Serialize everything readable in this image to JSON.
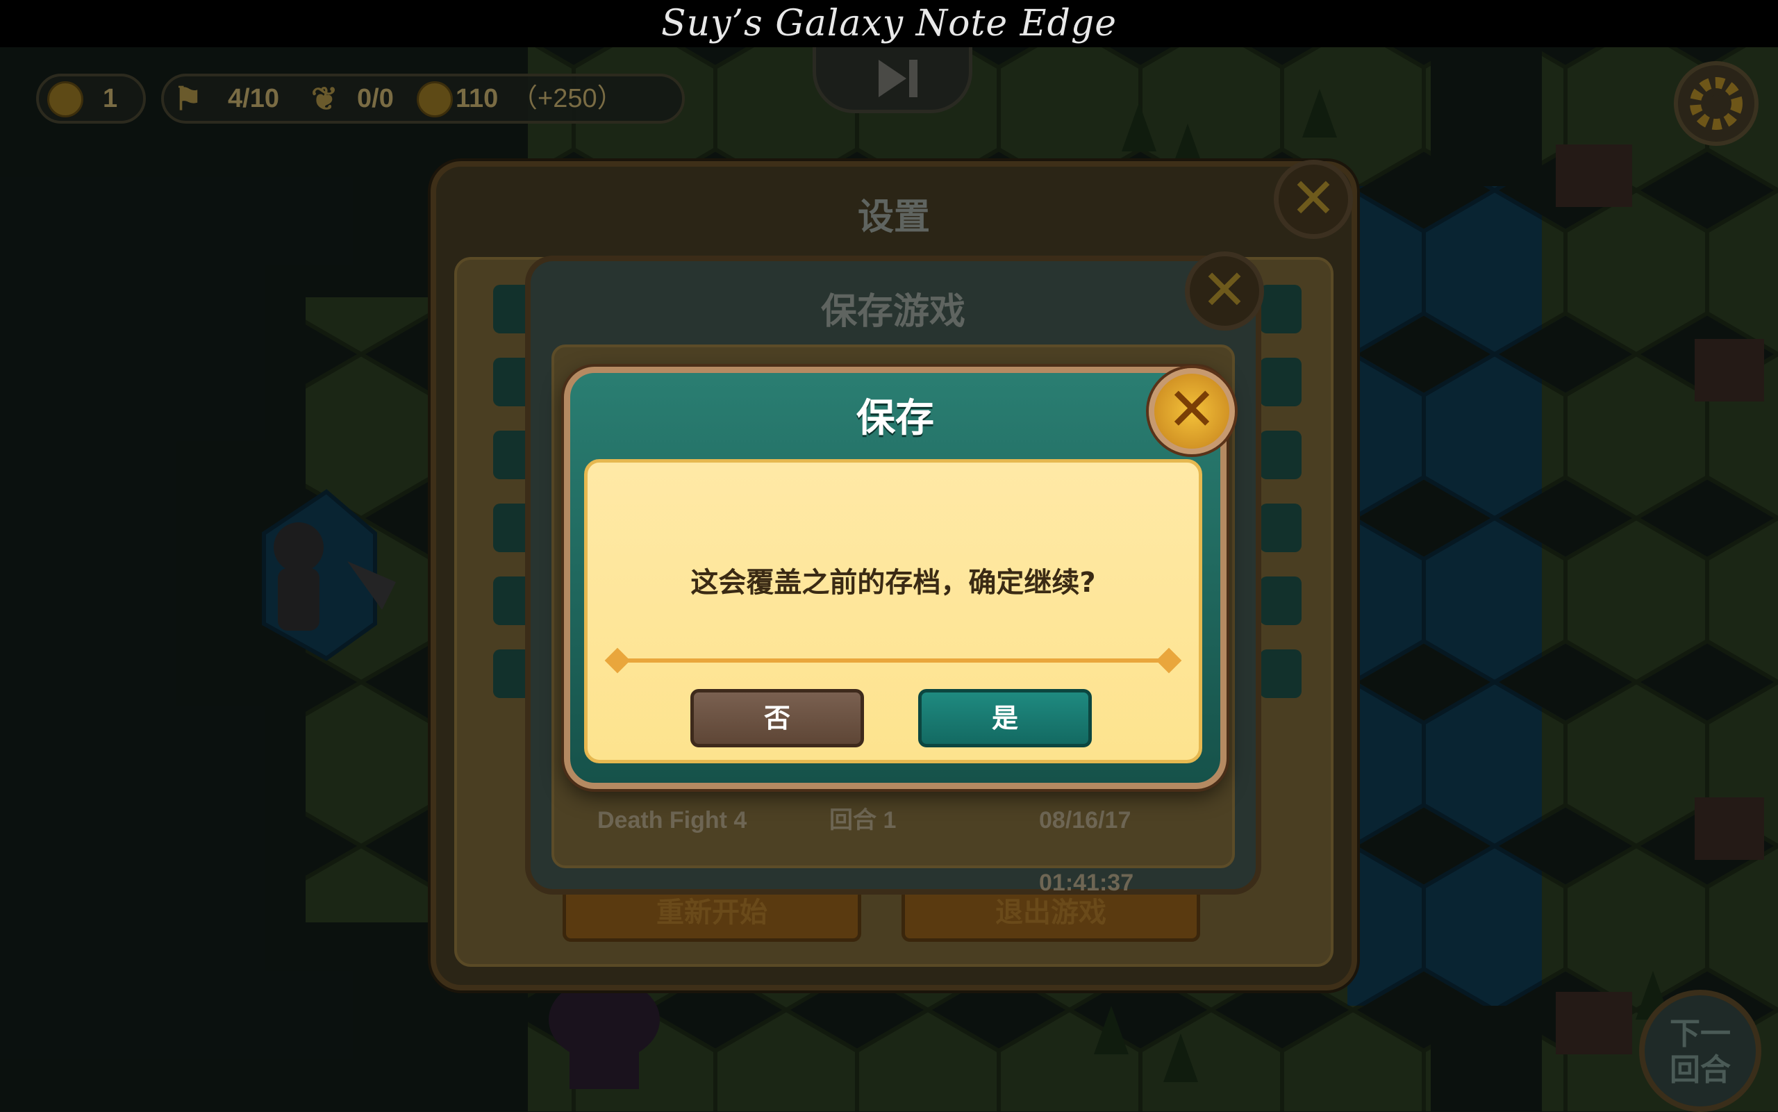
{
  "window": {
    "title": "Suy’s Galaxy Note Edge"
  },
  "hud": {
    "turn_count": "1",
    "population": "4/10",
    "food": "0/0",
    "gold": "110",
    "gold_income": "（+250）"
  },
  "next_turn": {
    "label_line1": "下一",
    "label_line2": "回合"
  },
  "settings_panel": {
    "title": "设置",
    "restart_label": "重新开始",
    "quit_label": "退出游戏"
  },
  "save_panel": {
    "title": "保存游戏",
    "slot": {
      "name": "Death Fight 4",
      "turn": "回合 1",
      "timestamp": "08/16/17 01:41:37"
    }
  },
  "confirm_dialog": {
    "title": "保存",
    "message": "这会覆盖之前的存档，确定继续?",
    "no_label": "否",
    "yes_label": "是"
  },
  "colors": {
    "dialog_header": "#1f6e64",
    "dialog_body": "#fde89a",
    "close_button": "#f0b62e",
    "yes_button": "#1c8078",
    "no_button": "#6e5444"
  },
  "icons": [
    "gear-icon",
    "skip-turn-icon",
    "close-icon",
    "coin-icon",
    "wheat-icon",
    "population-icon",
    "turn-icon"
  ]
}
